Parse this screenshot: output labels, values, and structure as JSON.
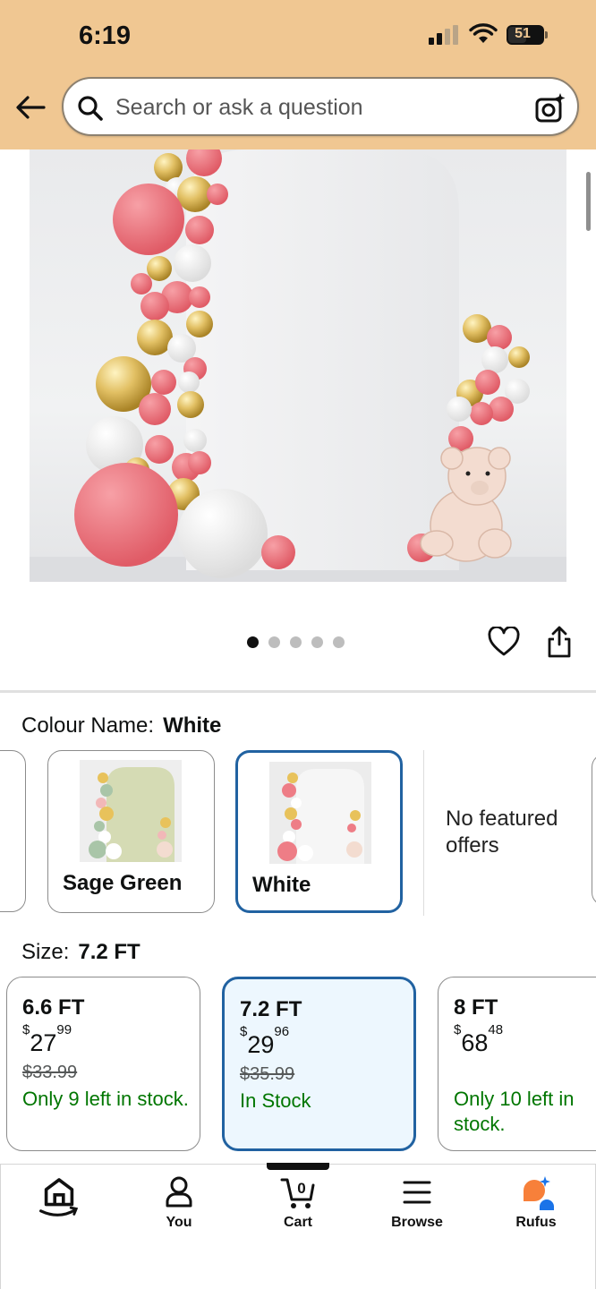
{
  "status_bar": {
    "time": "6:19",
    "battery": "51"
  },
  "search": {
    "placeholder": "Search or ask a question"
  },
  "gallery": {
    "dots_count": 5,
    "active_index": 0
  },
  "colour": {
    "label": "Colour Name:",
    "selected": "White",
    "options": [
      {
        "name": "Sage Green"
      },
      {
        "name": "White"
      }
    ],
    "no_offers": "No featured offers"
  },
  "size": {
    "label": "Size:",
    "selected": "7.2 FT",
    "options": [
      {
        "size": "6.6 FT",
        "price_dollars": "27",
        "price_cents": "99",
        "was": "$33.99",
        "stock": "Only 9 left in stock."
      },
      {
        "size": "7.2 FT",
        "price_dollars": "29",
        "price_cents": "96",
        "was": "$35.99",
        "stock": "In Stock"
      },
      {
        "size": "8 FT",
        "price_dollars": "68",
        "price_cents": "48",
        "was": "",
        "stock": "Only 10 left in stock."
      }
    ]
  },
  "nav": {
    "home": "",
    "you": "You",
    "cart": "Cart",
    "cart_count": "0",
    "browse": "Browse",
    "rufus": "Rufus"
  },
  "colors": {
    "header": "#f0c792",
    "selected_border": "#2162a1",
    "stock_green": "#007600",
    "rufus_orange": "#f7803a",
    "rufus_blue": "#1a73e8"
  }
}
